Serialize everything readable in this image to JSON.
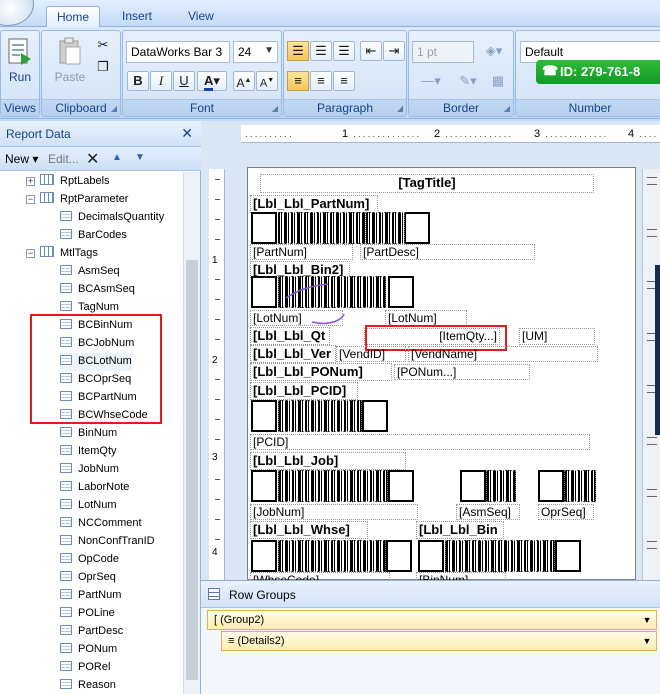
{
  "tabs": [
    "Home",
    "Insert",
    "View"
  ],
  "ribbon": {
    "views": {
      "run_label": "Run",
      "group_label": "Views"
    },
    "clipboard": {
      "paste_label": "Paste",
      "group_label": "Clipboard"
    },
    "font": {
      "family": "DataWorks Bar 3",
      "size": "24",
      "group_label": "Font"
    },
    "paragraph": {
      "group_label": "Paragraph"
    },
    "border": {
      "width": "1 pt",
      "group_label": "Border"
    },
    "number": {
      "format": "Default",
      "group_label": "Number"
    },
    "id_badge": "ID: 279-761-8"
  },
  "report_data": {
    "title": "Report Data",
    "new_label": "New ▾",
    "edit_label": "Edit...",
    "tree": [
      {
        "label": "RptLabels",
        "type": "table",
        "expander": "+",
        "level": 0
      },
      {
        "label": "RptParameter",
        "type": "table",
        "expander": "−",
        "level": 0
      },
      {
        "label": "DecimalsQuantity",
        "type": "field",
        "level": 1
      },
      {
        "label": "BarCodes",
        "type": "field",
        "level": 1
      },
      {
        "label": "MtlTags",
        "type": "table",
        "expander": "−",
        "level": 0
      },
      {
        "label": "AsmSeq",
        "type": "field",
        "level": 1
      },
      {
        "label": "BCAsmSeq",
        "type": "field",
        "level": 1
      },
      {
        "label": "TagNum",
        "type": "field",
        "level": 1
      },
      {
        "label": "BCBinNum",
        "type": "field",
        "level": 1
      },
      {
        "label": "BCJobNum",
        "type": "field",
        "level": 1
      },
      {
        "label": "BCLotNum",
        "type": "field",
        "level": 1
      },
      {
        "label": "BCOprSeq",
        "type": "field",
        "level": 1
      },
      {
        "label": "BCPartNum",
        "type": "field",
        "level": 1
      },
      {
        "label": "BCWhseCode",
        "type": "field",
        "level": 1
      },
      {
        "label": "BinNum",
        "type": "field",
        "level": 1
      },
      {
        "label": "ItemQty",
        "type": "field",
        "level": 1
      },
      {
        "label": "JobNum",
        "type": "field",
        "level": 1
      },
      {
        "label": "LaborNote",
        "type": "field",
        "level": 1
      },
      {
        "label": "LotNum",
        "type": "field",
        "level": 1
      },
      {
        "label": "NCComment",
        "type": "field",
        "level": 1
      },
      {
        "label": "NonConfTranID",
        "type": "field",
        "level": 1
      },
      {
        "label": "OpCode",
        "type": "field",
        "level": 1
      },
      {
        "label": "OprSeq",
        "type": "field",
        "level": 1
      },
      {
        "label": "PartNum",
        "type": "field",
        "level": 1
      },
      {
        "label": "POLine",
        "type": "field",
        "level": 1
      },
      {
        "label": "PartDesc",
        "type": "field",
        "level": 1
      },
      {
        "label": "PONum",
        "type": "field",
        "level": 1
      },
      {
        "label": "PORel",
        "type": "field",
        "level": 1
      },
      {
        "label": "Reason",
        "type": "field",
        "level": 1
      }
    ]
  },
  "ruler": {
    "h": [
      "1",
      "2",
      "3",
      "4"
    ],
    "v": [
      "1",
      "2",
      "3",
      "4"
    ]
  },
  "report": {
    "tag_title": "[TagTitle]",
    "lbl_partnum": "[Lbl_Lbl_PartNum]",
    "partnum": "[PartNum]",
    "partdesc": "[PartDesc]",
    "lbl_bin2": "[Lbl_Lbl_Bin2]",
    "lotnum_a": "[LotNum]",
    "lotnum_b": "[LotNum]",
    "lbl_qty": "[Lbl_Lbl_Qt",
    "itemqty": "[ItemQty...]",
    "um": "[UM]",
    "lbl_ven": "[Lbl_Lbl_Ver",
    "vendid": "[VendID]",
    "vendname": "[VendName]",
    "lbl_ponum": "[Lbl_Lbl_PONum]",
    "ponum": "[PONum...]",
    "lbl_pcid": "[Lbl_Lbl_PCID]",
    "pcid": "[PCID]",
    "lbl_job": "[Lbl_Lbl_Job]",
    "jobnum": "[JobNum]",
    "asmseq": "[AsmSeq]",
    "oprseq": "OprSeq]",
    "lbl_whse": "[Lbl_Lbl_Whse]",
    "lbl_bin": "[Lbl_Lbl_Bin",
    "whsecode": "[WhseCode]",
    "binnum": "[BinNum]"
  },
  "row_groups": {
    "title": "Row Groups",
    "group": "(Group2)",
    "details": "(Details2)"
  },
  "colors": {
    "accent": "#15428b",
    "highlight": "#e31b1b",
    "badge": "#1fa92f"
  }
}
